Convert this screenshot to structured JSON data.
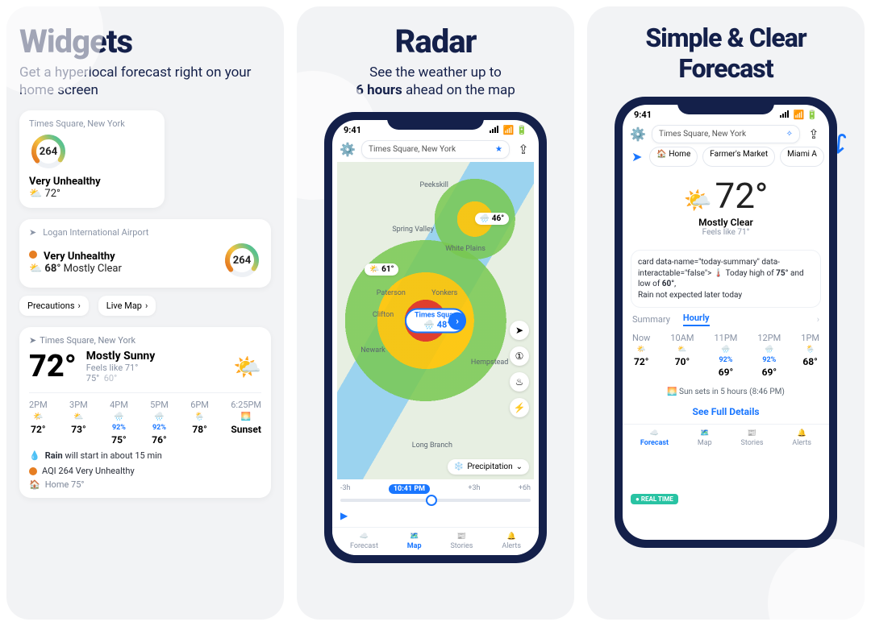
{
  "panel1": {
    "title": "Widgets",
    "subtitle": "Get a hyperlocal forecast right on your home screen",
    "aqiSmall": {
      "loc": "Times Square, New York",
      "value": "264",
      "label": "Very Unhealthy",
      "temp": "72°"
    },
    "aqiWide": {
      "loc": "Logan International Airport",
      "label": "Very Unhealthy",
      "temp": "68°",
      "cond": "Mostly Clear",
      "value": "264"
    },
    "pills": {
      "precautions": "Precautions",
      "livemap": "Live Map"
    },
    "main": {
      "loc": "Times Square, New York",
      "temp": "72°",
      "cond": "Mostly Sunny",
      "feels": "Feels like 71°",
      "hi": "75°",
      "lo": "60°",
      "hours": [
        {
          "t": "2PM",
          "temp": "72°",
          "pct": ""
        },
        {
          "t": "3PM",
          "temp": "73°",
          "pct": ""
        },
        {
          "t": "4PM",
          "temp": "75°",
          "pct": "92%"
        },
        {
          "t": "5PM",
          "temp": "76°",
          "pct": "92%"
        },
        {
          "t": "6PM",
          "temp": "78°",
          "pct": ""
        },
        {
          "t": "6:25PM",
          "temp": "Sunset",
          "pct": ""
        }
      ],
      "rain": "Rain will start in about 15 min",
      "aqiLine": "AQI 264 Very Unhealthy",
      "home": "Home 75°"
    }
  },
  "panel2": {
    "title": "Radar",
    "sub_a": "See the weather up to",
    "sub_b": "6 hours",
    "sub_c": " ahead on the map",
    "phone": {
      "time": "9:41",
      "search": "Times Square, New York",
      "pill": {
        "name": "Times Square",
        "temp": "48°"
      },
      "labels": {
        "peekskill": "Peekskill",
        "springvalley": "Spring Valley",
        "whiteplains": "White Plains",
        "paterson": "Paterson",
        "yonkers": "Yonkers",
        "clifton": "Clifton",
        "newark": "Newark",
        "hempstead": "Hempstead",
        "longbranch": "Long Branch"
      },
      "pins": {
        "a": "61°",
        "b": "46°"
      },
      "layer": "Precipitation",
      "tl": {
        "m3": "-3h",
        "now": "10:41 PM",
        "p3": "+3h",
        "p6": "+6h"
      },
      "tabs": {
        "forecast": "Forecast",
        "map": "Map",
        "stories": "Stories",
        "alerts": "Alerts"
      }
    }
  },
  "panel3": {
    "title": "Simple & Clear Forecast",
    "phone": {
      "time": "9:41",
      "search": "Times Square, New York",
      "chips": {
        "home": "Home",
        "farmers": "Farmer's Market",
        "miami": "Miami A"
      },
      "hero": {
        "temp": "72°",
        "cond": "Mostly Clear",
        "feel": "Feels like 71°"
      },
      "today": {
        "pre": "Today ",
        "hi_label": "high of ",
        "hi": "75°",
        "and": " and ",
        "lo_label": "low of ",
        "lo": "60°",
        "line2": "Rain not expected later today"
      },
      "tabs2": {
        "summary": "Summary",
        "hourly": "Hourly"
      },
      "hourly": [
        {
          "t": "Now",
          "temp": "72°",
          "pct": ""
        },
        {
          "t": "10AM",
          "temp": "70°",
          "pct": ""
        },
        {
          "t": "11PM",
          "temp": "69°",
          "pct": "92%"
        },
        {
          "t": "12PM",
          "temp": "69°",
          "pct": "92%"
        },
        {
          "t": "1PM",
          "temp": "68°",
          "pct": ""
        }
      ],
      "sunset": "Sun sets in 5 hours (8:46 PM)",
      "seefull": "See Full Details",
      "realtime": "REAL TIME",
      "tabs": {
        "forecast": "Forecast",
        "map": "Map",
        "stories": "Stories",
        "alerts": "Alerts"
      }
    }
  }
}
